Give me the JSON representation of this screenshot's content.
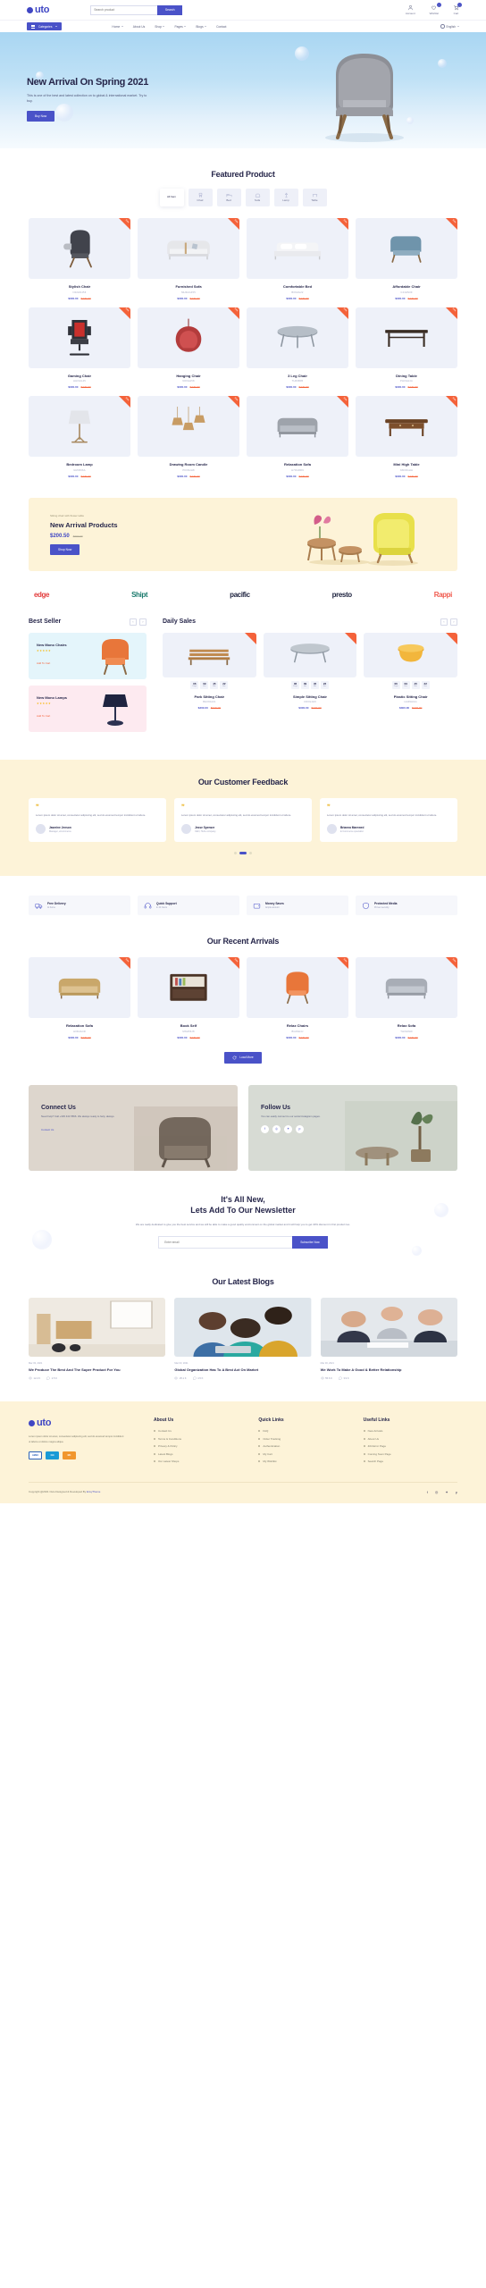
{
  "brand": {
    "name": "uto",
    "accent": "#4a52c8",
    "orange": "#f4623a",
    "cream": "#fdf3d8"
  },
  "header": {
    "search": {
      "placeholder": "Search product",
      "button": "Search"
    },
    "icons": [
      {
        "name": "Account",
        "icon": "user-icon",
        "badge": ""
      },
      {
        "name": "Wishlist",
        "icon": "heart-icon",
        "badge": "0"
      },
      {
        "name": "Cart",
        "icon": "cart-icon",
        "badge": "0"
      }
    ]
  },
  "nav": {
    "categories_label": "Categories",
    "menu": [
      "Home",
      "About Us",
      "Shop",
      "Pages",
      "Blogs",
      "Contact"
    ],
    "language": "English"
  },
  "hero": {
    "title": "New Arrival On Spring 2021",
    "subtitle": "This is one of the best and latest collection on to global & international market. Try to buy.",
    "cta": "Buy Now"
  },
  "featured": {
    "title": "Featured Product",
    "filters": [
      {
        "label": "All Item",
        "icon": "grid-icon",
        "active": true
      },
      {
        "label": "Chair",
        "icon": "chair-icon",
        "active": false
      },
      {
        "label": "Bed",
        "icon": "bed-icon",
        "active": false
      },
      {
        "label": "Sofa",
        "icon": "sofa-icon",
        "active": false
      },
      {
        "label": "Lamp",
        "icon": "lamp-icon",
        "active": false
      },
      {
        "label": "Table",
        "icon": "table-icon",
        "active": false
      }
    ],
    "products": [
      {
        "name": "Stylish Chair",
        "code": "N02HN456",
        "new": "$300.00",
        "old": "$420.00",
        "ribbon": "Sale",
        "art": "chair-dark"
      },
      {
        "name": "Furnished Sofa",
        "code": "MH3HG455",
        "new": "$300.00",
        "old": "$420.00",
        "ribbon": "Sale",
        "art": "sofa-white"
      },
      {
        "name": "Comfortable Bed",
        "code": "B09HG22",
        "new": "$300.00",
        "old": "$420.00",
        "ribbon": "Sale",
        "art": "bed-white"
      },
      {
        "name": "Affordable Chair",
        "code": "C44HN09",
        "new": "$300.00",
        "old": "$420.00",
        "ribbon": "Sale",
        "art": "chair-blue"
      },
      {
        "name": "Gaming Chair",
        "code": "HH0GG45",
        "new": "$300.00",
        "old": "$420.00",
        "ribbon": "Sale",
        "art": "chair-gaming"
      },
      {
        "name": "Hanging Chair",
        "code": "N09GH58",
        "new": "$300.00",
        "old": "$420.00",
        "ribbon": "Sale",
        "art": "chair-hanging"
      },
      {
        "name": "3 Leg Chair",
        "code": "TH09B95",
        "new": "$300.00",
        "old": "$420.00",
        "ribbon": "Sale",
        "art": "table-round"
      },
      {
        "name": "Dining Table",
        "code": "PH0GH4A",
        "new": "$300.00",
        "old": "$420.00",
        "ribbon": "Sale",
        "art": "table-dining"
      },
      {
        "name": "Bedroom Lamp",
        "code": "GM4566A",
        "new": "$300.00",
        "old": "$420.00",
        "ribbon": "Sale",
        "art": "lamp-floor"
      },
      {
        "name": "Drawing Room Candle",
        "code": "PK09HH8",
        "new": "$300.00",
        "old": "$420.00",
        "ribbon": "Sale",
        "art": "lamp-pendant"
      },
      {
        "name": "Relaxation Sofa",
        "code": "H70GRR9",
        "new": "$300.00",
        "old": "$420.00",
        "ribbon": "Sale",
        "art": "sofa-grey"
      },
      {
        "name": "Mini High Table",
        "code": "N8O9GHH",
        "new": "$300.00",
        "old": "$420.00",
        "ribbon": "Sale",
        "art": "table-console"
      }
    ]
  },
  "promo": {
    "kicker": "Sitting chair with flower table",
    "title": "New Arrival Products",
    "price": "$200.50",
    "old_price": "$300.00",
    "cta": "Shop Now"
  },
  "brands": [
    "edge",
    "Shipt",
    "pacific",
    "presto",
    "Rappi"
  ],
  "best_seller": {
    "title": "Best Seller",
    "cards": [
      {
        "title": "New Mono Chairs",
        "stars": "★★★★★",
        "link": "Add To Cart",
        "art": "chair-orange"
      },
      {
        "title": "New Mono Lamps",
        "stars": "★★★★★",
        "link": "Add To Cart",
        "art": "lamp-small"
      }
    ]
  },
  "daily_sales": {
    "title": "Daily Sales",
    "products": [
      {
        "name": "Park Sitting Chair",
        "code": "BH09GGS",
        "new": "$300.00",
        "old": "$420.00",
        "art": "bench-wood",
        "timer": [
          {
            "v": "06",
            "l": "Days"
          },
          {
            "v": "09",
            "l": "Hrs"
          },
          {
            "v": "45",
            "l": "Min"
          },
          {
            "v": "22",
            "l": "Sec"
          }
        ]
      },
      {
        "name": "Simple Sitting Chair",
        "code": "CD0G4H6",
        "new": "$300.00",
        "old": "$420.00",
        "art": "table-glass",
        "timer": [
          {
            "v": "06",
            "l": "Days"
          },
          {
            "v": "09",
            "l": "Hrs"
          },
          {
            "v": "45",
            "l": "Min"
          },
          {
            "v": "22",
            "l": "Sec"
          }
        ]
      },
      {
        "name": "Plastic Sitting Chair",
        "code": "HH09HGG",
        "new": "$300.00",
        "old": "$420.00",
        "art": "stool-yellow",
        "timer": [
          {
            "v": "06",
            "l": "Days"
          },
          {
            "v": "09",
            "l": "Hrs"
          },
          {
            "v": "45",
            "l": "Min"
          },
          {
            "v": "22",
            "l": "Sec"
          }
        ]
      }
    ]
  },
  "feedback": {
    "title": "Our Customer Feedback",
    "items": [
      {
        "text": "Lorem ipsum dolor sit amet, consectetur adipiscing elit, sed do eiusmod tempor incididunt ut labore.",
        "name": "Jasmine Jenson",
        "role": "Manager, eCommerce"
      },
      {
        "text": "Lorem ipsum dolor sit amet, consectetur adipiscing elit, sed do eiusmod tempor incididunt ut labore.",
        "name": "Jesse Spenser",
        "role": "CEO, Hubs company"
      },
      {
        "text": "Lorem ipsum dolor sit amet, consectetur adipiscing elit, sed do eiusmod tempor incididunt ut labore.",
        "name": "Brianna Marewed",
        "role": "E Commerce specialist"
      }
    ]
  },
  "features": [
    {
      "title": "Free Delivery",
      "sub": "At home",
      "icon": "truck-icon"
    },
    {
      "title": "Quick Support",
      "sub": "In 24 hours",
      "icon": "headset-icon"
    },
    {
      "title": "Money Saves",
      "sub": "Ample amount",
      "icon": "wallet-icon"
    },
    {
      "title": "Protected Media",
      "sub": "Proven security",
      "icon": "shield-icon"
    }
  ],
  "arrivals": {
    "title": "Our Recent Arrivals",
    "products": [
      {
        "name": "Relaxation Sofa",
        "code": "H09HG4R",
        "new": "$300.00",
        "old": "$420.00",
        "ribbon": "Sale",
        "art": "sofa-beige"
      },
      {
        "name": "Book Self",
        "code": "MNH56J8",
        "new": "$300.00",
        "old": "$420.00",
        "ribbon": "Sale",
        "art": "bookshelf"
      },
      {
        "name": "Relax Chairs",
        "code": "BG09H4J",
        "new": "$300.00",
        "old": "$420.00",
        "ribbon": "Sale",
        "art": "chair-orange2"
      },
      {
        "name": "Relax Sofa",
        "code": "TH0G8H9",
        "new": "$300.00",
        "old": "$420.00",
        "ribbon": "Sale",
        "art": "sofa-grey2"
      }
    ],
    "load_more": "Load More"
  },
  "connect": {
    "title": "Connect Us",
    "text": "Need help? Call +345 444 5566. We always ready to help, always.",
    "link": "Contact Us"
  },
  "follow": {
    "title": "Follow Us",
    "text": "You can easily connect to our social instagram pages.",
    "socials": [
      "f",
      "◎",
      "✦",
      "p"
    ]
  },
  "newsletter": {
    "title_line1": "It's All New,",
    "title_line2": "Lets Add To Our Newsletter",
    "text": "We are really dedicated to give you the best service and we will be able to make a good quality environment on the global market and it will help you to get 40% discount in first product too.",
    "placeholder": "Enter email",
    "cta": "Subscribe Now"
  },
  "blogs": {
    "title": "Our Latest Blogs",
    "items": [
      {
        "date": "Mar 03, 2021",
        "title": "We Produce The Best And The Super Product For You",
        "views": "12.2 K",
        "comments": "2.5 K",
        "art": "nursery"
      },
      {
        "date": "Mar 03, 2021",
        "title": "Global Organization Has To A Best Act On Market",
        "views": "25.1 K",
        "comments": "4.5 K",
        "art": "team"
      },
      {
        "date": "Mar 03, 2021",
        "title": "We Work To Make A Good & Better Relationship",
        "views": "55.6 K",
        "comments": "3.9 K",
        "art": "meeting"
      }
    ]
  },
  "footer": {
    "desc": "Lorem ipsum dolor sit amet, consectetur adipiscing elit, sed do eiusmod tempor incididunt ut labore et dolore magna aliqua.",
    "cards": [
      {
        "label": "AMEX",
        "bg": "#ffffff",
        "fg": "#2c63b8"
      },
      {
        "label": "Citi",
        "bg": "#1a9ad6",
        "fg": "#ffffff"
      },
      {
        "label": "MC",
        "bg": "#f1962d",
        "fg": "#ffffff"
      }
    ],
    "columns": [
      {
        "heading": "About Us",
        "links": [
          "Contact Us",
          "Terms & Conditions",
          "Privacy & Policy",
          "Latest Blogs",
          "Our Latest Shops"
        ]
      },
      {
        "heading": "Quick Links",
        "links": [
          "FAQ",
          "Order Tracking",
          "Authentication",
          "My Cart",
          "My Wishlist"
        ]
      },
      {
        "heading": "Useful Links",
        "links": [
          "New Arrivals",
          "About Us",
          "404 Error Page",
          "Coming Soon Page",
          "Search Page"
        ]
      }
    ],
    "copyright_pre": "Copyright @2021 Outo Designed & Developed By ",
    "copyright_brand": "EnvyTheme",
    "socials": [
      "f",
      "◎",
      "✦",
      "p"
    ]
  }
}
